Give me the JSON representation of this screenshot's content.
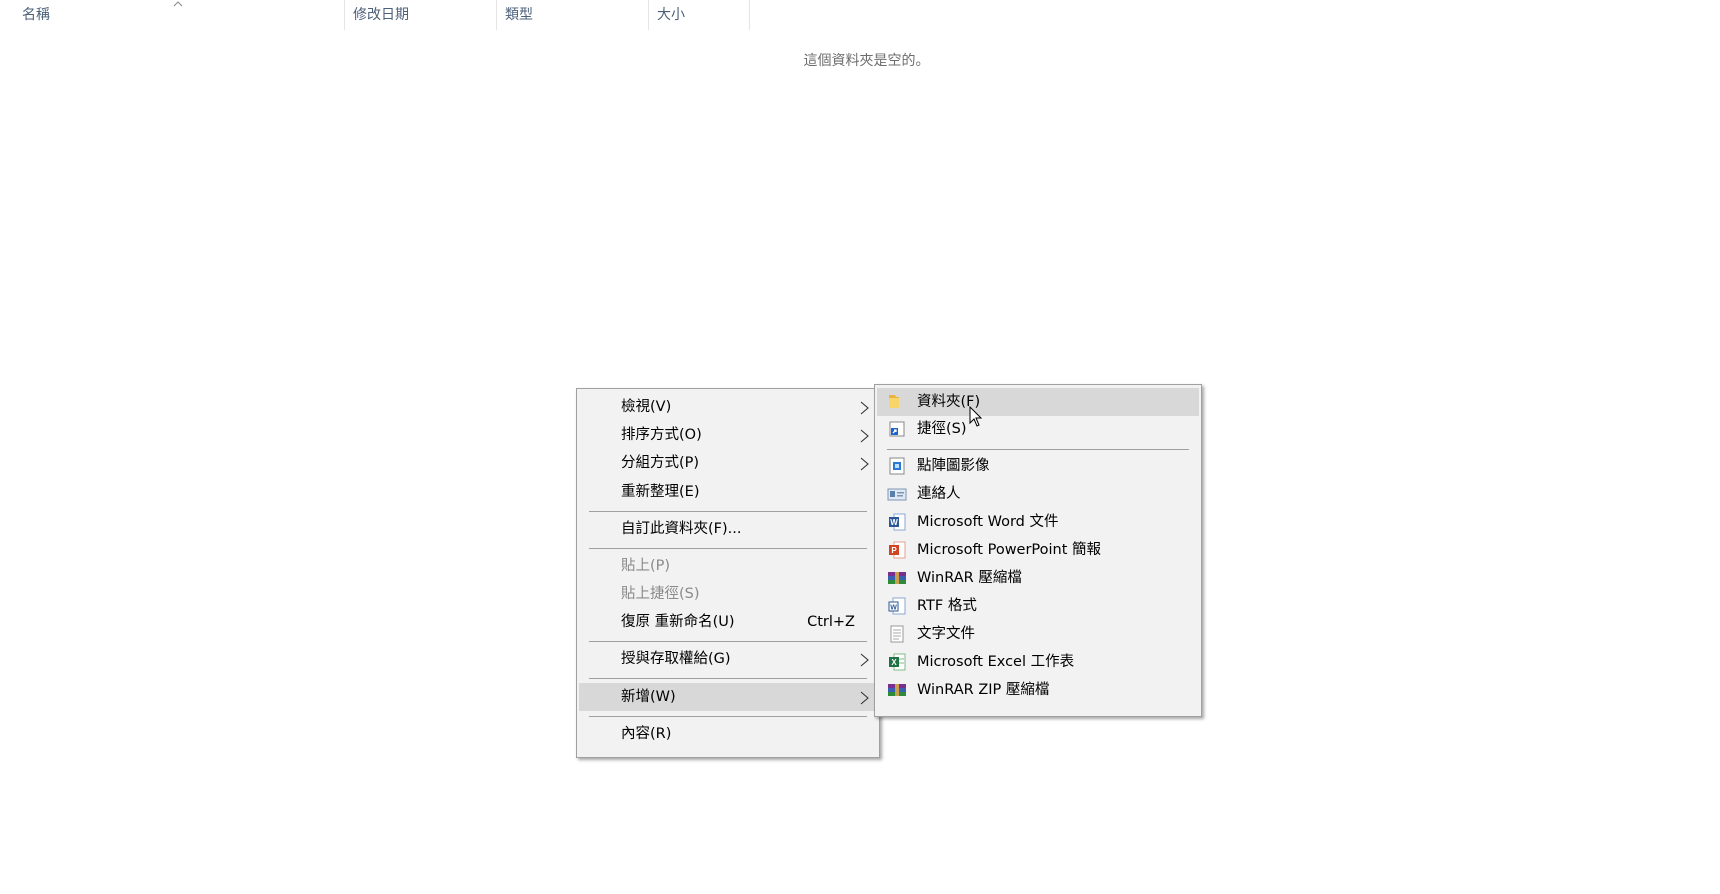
{
  "columns": {
    "name": "名稱",
    "modified": "修改日期",
    "type": "類型",
    "size": "大小"
  },
  "empty_message": "這個資料夾是空的。",
  "context_menu": {
    "view": "檢視(V)",
    "sort": "排序方式(O)",
    "group": "分組方式(P)",
    "refresh": "重新整理(E)",
    "customize": "自訂此資料夾(F)...",
    "paste": "貼上(P)",
    "paste_shortcut": "貼上捷徑(S)",
    "undo_rename": "復原 重新命名(U)",
    "undo_shortcut": "Ctrl+Z",
    "give_access": "授與存取權給(G)",
    "new": "新增(W)",
    "properties": "內容(R)"
  },
  "new_submenu": {
    "folder": "資料夾(F)",
    "shortcut": "捷徑(S)",
    "bitmap": "點陣圖影像",
    "contact": "連絡人",
    "word": "Microsoft Word 文件",
    "powerpoint": "Microsoft PowerPoint 簡報",
    "winrar": "WinRAR 壓縮檔",
    "rtf": "RTF 格式",
    "text": "文字文件",
    "excel": "Microsoft Excel 工作表",
    "winrar_zip": "WinRAR ZIP 壓縮檔"
  },
  "icons": {
    "sort_arrow": "chevron-up-icon",
    "submenu_arrow": "chevron-right-icon",
    "folder": "folder-icon",
    "shortcut": "shortcut-icon",
    "bitmap": "bitmap-image-icon",
    "contact": "contact-card-icon",
    "word": "word-document-icon",
    "powerpoint": "powerpoint-icon",
    "winrar": "winrar-archive-icon",
    "rtf": "rtf-document-icon",
    "text": "text-document-icon",
    "excel": "excel-worksheet-icon",
    "winrar_zip": "winrar-zip-icon",
    "cursor": "mouse-cursor-icon"
  },
  "colors": {
    "menu_bg": "#f2f2f2",
    "menu_highlight": "#d8d8d8",
    "header_text": "#4c607a",
    "disabled_text": "#8a8a8a"
  }
}
